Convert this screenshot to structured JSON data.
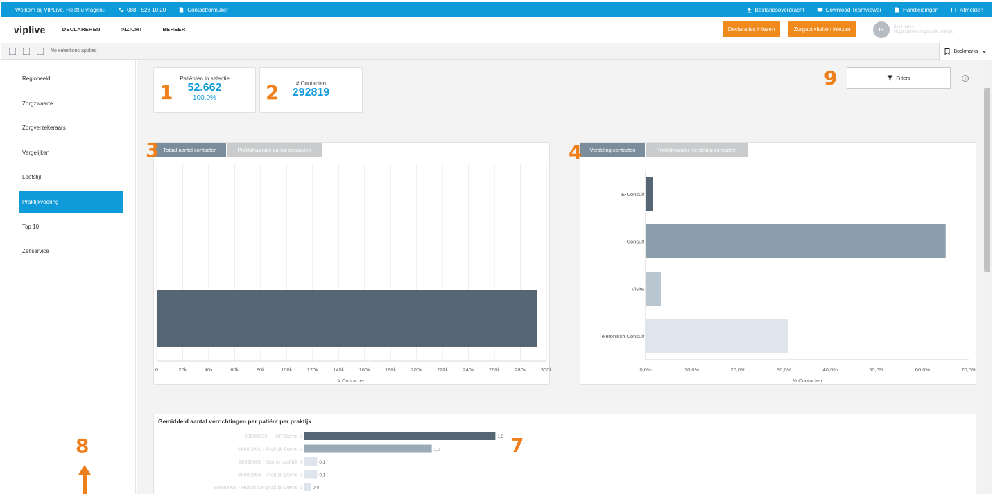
{
  "infobar": {
    "welcome": "Welkom bij VIPLive. Heeft u vragen?",
    "phone": "088 - 528 10 20",
    "contact": "Contactformulier",
    "transfer": "Bestandsoverdracht",
    "teamviewer": "Download Teamviewer",
    "manuals": "Handleidingen",
    "logout": "Afmelden"
  },
  "nav": {
    "logo": "viplive",
    "links": [
      "DECLAREREN",
      "INZICHT",
      "BEHEER"
    ],
    "btn_declaraties": "Declaraties inlezen",
    "btn_zorgactiviteiten": "Zorgactiviteiten inlezen",
    "avatar_initials": "IH",
    "user_line1": "Ilse Harms",
    "user_line2": "Hoge Demo's registratie praktijk"
  },
  "selbar": {
    "no_selections": "No selections applied",
    "bookmarks": "Bookmarks"
  },
  "sidebar": {
    "items": [
      "Regiobeeld",
      "Zorgzwaarte",
      "Zorgverzekeraars",
      "Vergelijken",
      "Leefstijl",
      "Praktijkvoering",
      "Top 10",
      "Zelfservice"
    ],
    "active_index": 5
  },
  "kpi": {
    "patients_label": "Patiënten in selectie",
    "patients_value": "52.662",
    "patients_pct": "100,0%",
    "contacts_label": "# Contacten",
    "contacts_value": "292819"
  },
  "filters_label": "Filters",
  "info_symbol": "i",
  "annotations": [
    "1",
    "2",
    "3",
    "4",
    "7",
    "8",
    "9"
  ],
  "chart1": {
    "tab_active": "Totaal aantal contacten",
    "tab_inactive": "Praktijkvariatie aantal contacten"
  },
  "chart2": {
    "tab_active": "Verdeling contacten",
    "tab_inactive": "Praktijkvariatie verdeling contacten"
  },
  "chart3": {
    "title": "Gemiddeld aantal verrichtingen per patiënt per praktijk"
  },
  "chart_data": [
    {
      "type": "bar",
      "orientation": "horizontal",
      "categories": [
        ""
      ],
      "values": [
        292819
      ],
      "xlabel": "# Contacten",
      "xlim": [
        0,
        300000
      ],
      "ticks": [
        "0",
        "20k",
        "40k",
        "60k",
        "80k",
        "100k",
        "120k",
        "140k",
        "160k",
        "180k",
        "200k",
        "220k",
        "240k",
        "260k",
        "280k",
        "300k"
      ],
      "color": "#566675",
      "grid": true
    },
    {
      "type": "bar",
      "orientation": "horizontal",
      "categories": [
        "E-Consult",
        "Consult",
        "Visite",
        "Telefonisch Consult"
      ],
      "values": [
        1.5,
        65.0,
        3.3,
        30.8
      ],
      "xlabel": "% Contacten",
      "xlim": [
        0,
        70
      ],
      "ticks": [
        "0,0%",
        "10,0%",
        "20,0%",
        "30,0%",
        "40,0%",
        "50,0%",
        "60,0%",
        "70,0%"
      ],
      "colors": [
        "#566675",
        "#8a9eac",
        "#b9c6d0",
        "#dfe5ec"
      ],
      "grid": false
    },
    {
      "type": "bar",
      "orientation": "horizontal",
      "categories": [
        "88880002 - HAP Demo 1",
        "88880001 - Praktijk Demo 1",
        "88880006 - Demo praktijk 4",
        "88880003 - Praktijk Demo 3",
        "88880005 - Huisartsenpraktijk Demo 5"
      ],
      "values": [
        1.5,
        1.0,
        0.1,
        0.1,
        0.0
      ],
      "labels": [
        "1,5",
        "1,0",
        "0,1",
        "0,1",
        "0,0"
      ],
      "xlim": [
        0,
        2.5
      ],
      "colors": [
        "#566675",
        "#9aabb8",
        "#dfe5ec",
        "#dfe5ec",
        "#dfe5ec"
      ]
    }
  ]
}
